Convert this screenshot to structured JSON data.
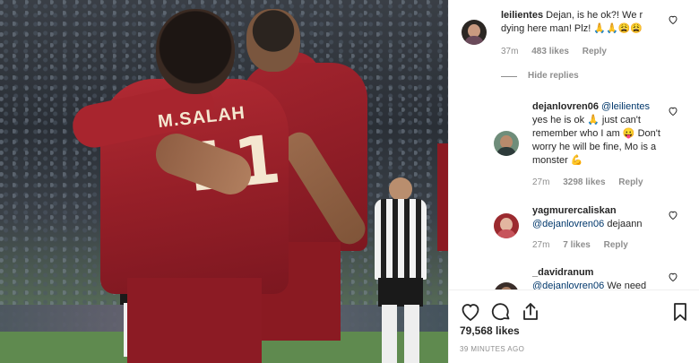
{
  "post": {
    "photo_alt": "Liverpool players embracing",
    "player_name": "M.SALAH",
    "player_number": "11"
  },
  "comments": [
    {
      "username": "leilientes",
      "text": "Dejan, is he ok?! We r dying here man! Plz! 🙏🙏😩😩",
      "time": "37m",
      "likes": "483 likes",
      "reply": "Reply"
    }
  ],
  "hide_replies_label": "Hide replies",
  "replies": [
    {
      "username": "dejanlovren06",
      "mention": "@leilientes",
      "text": "yes he is ok 🙏 just can't remember who I am 😛 Don't worry he will be fine, Mo is a monster 💪",
      "time": "27m",
      "likes": "3298 likes",
      "reply": "Reply"
    },
    {
      "username": "yagmurercaliskan",
      "mention": "@dejanlovren06",
      "text": "dejaann",
      "time": "27m",
      "likes": "7 likes",
      "reply": "Reply"
    },
    {
      "username": "_davidranum",
      "mention": "@dejanlovren06",
      "text": "We need",
      "time": "",
      "likes": "",
      "reply": ""
    }
  ],
  "actions": {
    "like_icon": "heart-icon",
    "comment_icon": "comment-icon",
    "share_icon": "share-icon",
    "save_icon": "bookmark-icon"
  },
  "likes_count": "79,568 likes",
  "time_ago": "39 MINUTES AGO"
}
